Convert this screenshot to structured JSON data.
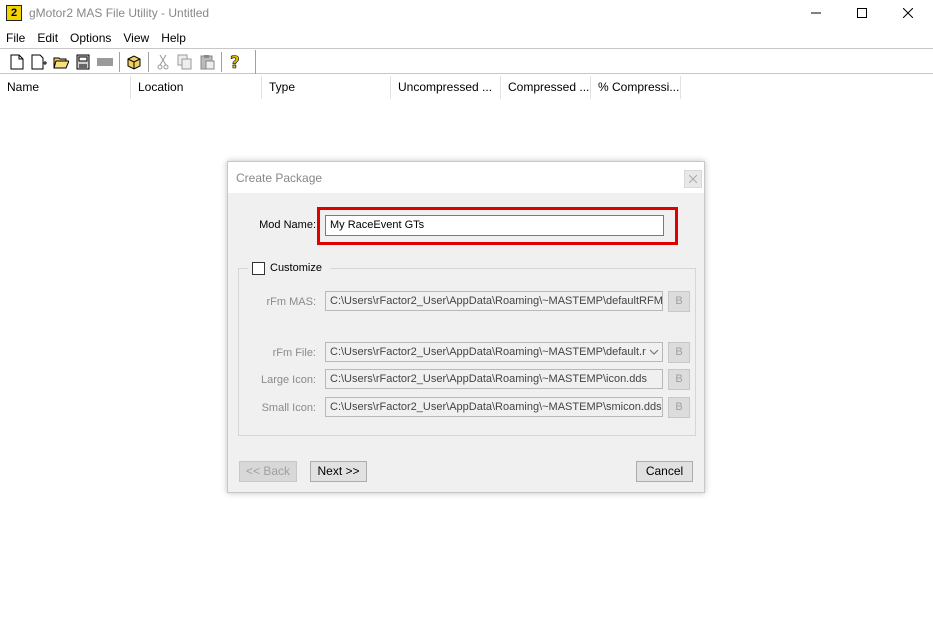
{
  "window": {
    "title": "gMotor2 MAS File Utility - Untitled",
    "app_icon_glyph": "2"
  },
  "menu": [
    "File",
    "Edit",
    "Options",
    "View",
    "Help"
  ],
  "toolbar_icons": [
    "new-file-icon",
    "add-file-icon",
    "open-folder-icon",
    "save-icon",
    "disabled-icon",
    "package-icon",
    "cut-icon",
    "copy-icon",
    "paste-icon",
    "help-icon"
  ],
  "columns": [
    "Name",
    "Location",
    "Type",
    "Uncompressed ...",
    "Compressed ...",
    "% Compressi..."
  ],
  "dialog": {
    "title": "Create Package",
    "mod_name_label": "Mod Name:",
    "mod_name_value": "My RaceEvent GTs",
    "customize_label": "Customize",
    "customize_checked": false,
    "rows": [
      {
        "label": "rFm MAS:",
        "value": "C:\\Users\\rFactor2_User\\AppData\\Roaming\\~MASTEMP\\defaultRFM.",
        "button": "B"
      },
      {
        "label": "rFm File:",
        "value": "C:\\Users\\rFactor2_User\\AppData\\Roaming\\~MASTEMP\\default.r",
        "button": "B"
      },
      {
        "label": "Large Icon:",
        "value": "C:\\Users\\rFactor2_User\\AppData\\Roaming\\~MASTEMP\\icon.dds",
        "button": "B"
      },
      {
        "label": "Small Icon:",
        "value": "C:\\Users\\rFactor2_User\\AppData\\Roaming\\~MASTEMP\\smicon.dds",
        "button": "B"
      }
    ],
    "back_label": "<< Back",
    "next_label": "Next >>",
    "cancel_label": "Cancel"
  },
  "colors": {
    "highlight": "#e00000",
    "dialog_bg": "#f0f0f0"
  }
}
